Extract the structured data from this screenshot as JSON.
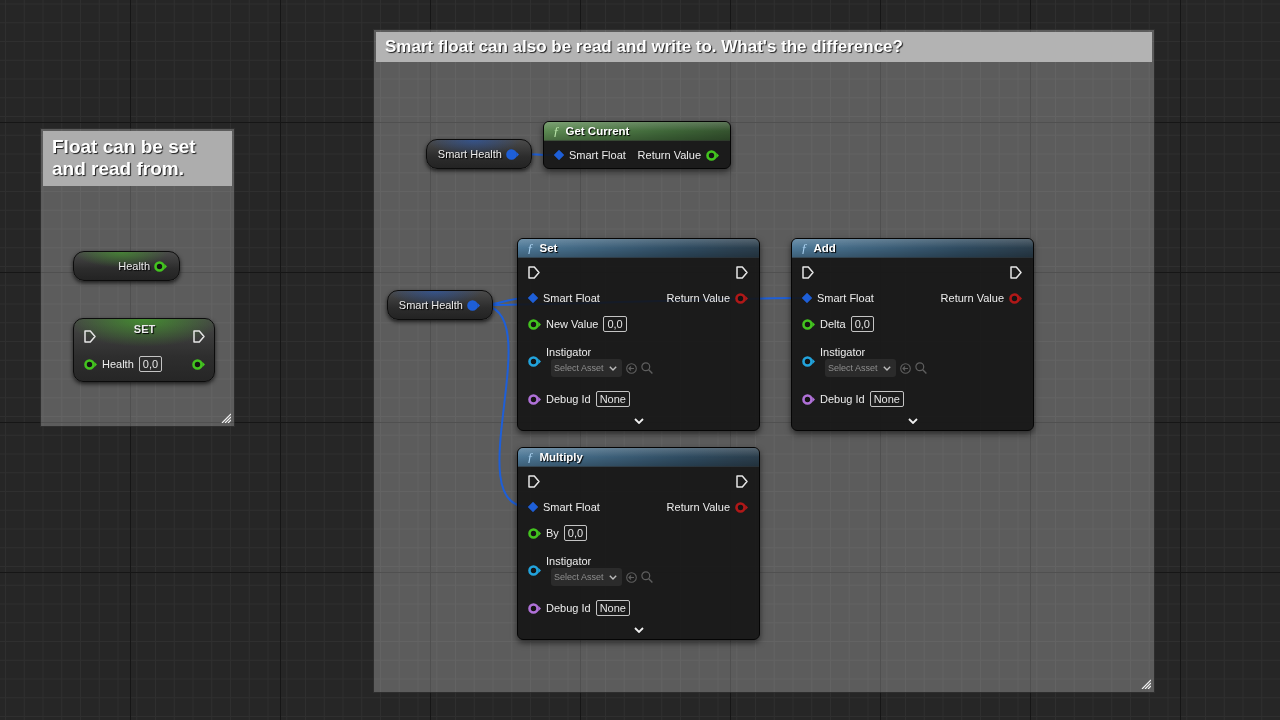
{
  "comments": [
    {
      "title": "Float can be set and read from.",
      "nodes": [
        {
          "kind": "variable",
          "label": "Health",
          "pin": {
            "kind": "value",
            "color": "#43c41f",
            "connected": false
          }
        },
        {
          "kind": "setter",
          "title": "SET",
          "exec": true,
          "inputs": [
            {
              "kind": "value",
              "label": "Health",
              "color": "#43c41f",
              "connected": false,
              "value": "0,0"
            }
          ],
          "outputs": [
            {
              "kind": "value",
              "color": "#43c41f",
              "connected": false
            }
          ]
        }
      ]
    },
    {
      "title": "Smart float can also be read and write to. What's the difference?",
      "nodes": [
        {
          "kind": "variable",
          "label": "Smart Health",
          "pin": {
            "kind": "value",
            "color": "#1e5fd8",
            "connected": true
          }
        },
        {
          "kind": "function",
          "icon": "ƒ",
          "title": "Get Current",
          "exec": false,
          "inputs": [
            {
              "kind": "reference",
              "label": "Smart Float",
              "color": "#1e5fd8",
              "connected": true
            }
          ],
          "outputs": [
            {
              "kind": "value",
              "label": "Return Value",
              "color": "#43c41f",
              "connected": false
            }
          ]
        },
        {
          "kind": "variable",
          "label": "Smart Health",
          "pin": {
            "kind": "value",
            "color": "#1e5fd8",
            "connected": true
          }
        },
        {
          "kind": "function",
          "icon": "ƒ",
          "title": "Set",
          "exec": true,
          "expanded": false,
          "inputs": [
            {
              "kind": "reference",
              "label": "Smart Float",
              "color": "#1e5fd8",
              "connected": true
            },
            {
              "kind": "value",
              "label": "New Value",
              "color": "#43c41f",
              "connected": false,
              "value": "0,0"
            },
            {
              "kind": "asset",
              "label": "Instigator",
              "color": "#22a3dc",
              "connected": false,
              "value": "Select Asset"
            },
            {
              "kind": "value",
              "label": "Debug Id",
              "color": "#b071d8",
              "connected": false,
              "value": "None"
            }
          ],
          "outputs": [
            {
              "kind": "value",
              "label": "Return Value",
              "color": "#b01818",
              "connected": false
            }
          ]
        },
        {
          "kind": "function",
          "icon": "ƒ",
          "title": "Add",
          "exec": true,
          "expanded": false,
          "inputs": [
            {
              "kind": "reference",
              "label": "Smart Float",
              "color": "#1e5fd8",
              "connected": true
            },
            {
              "kind": "value",
              "label": "Delta",
              "color": "#43c41f",
              "connected": false,
              "value": "0,0"
            },
            {
              "kind": "asset",
              "label": "Instigator",
              "color": "#22a3dc",
              "connected": false,
              "value": "Select Asset"
            },
            {
              "kind": "value",
              "label": "Debug Id",
              "color": "#b071d8",
              "connected": false,
              "value": "None"
            }
          ],
          "outputs": [
            {
              "kind": "value",
              "label": "Return Value",
              "color": "#b01818",
              "connected": false
            }
          ]
        },
        {
          "kind": "function",
          "icon": "ƒ",
          "title": "Multiply",
          "exec": true,
          "expanded": false,
          "inputs": [
            {
              "kind": "reference",
              "label": "Smart Float",
              "color": "#1e5fd8",
              "connected": true
            },
            {
              "kind": "value",
              "label": "By",
              "color": "#43c41f",
              "connected": false,
              "value": "0,0"
            },
            {
              "kind": "asset",
              "label": "Instigator",
              "color": "#22a3dc",
              "connected": false,
              "value": "Select Asset"
            },
            {
              "kind": "value",
              "label": "Debug Id",
              "color": "#b071d8",
              "connected": false,
              "value": "None"
            }
          ],
          "outputs": [
            {
              "kind": "value",
              "label": "Return Value",
              "color": "#b01818",
              "connected": false
            }
          ]
        }
      ]
    }
  ]
}
